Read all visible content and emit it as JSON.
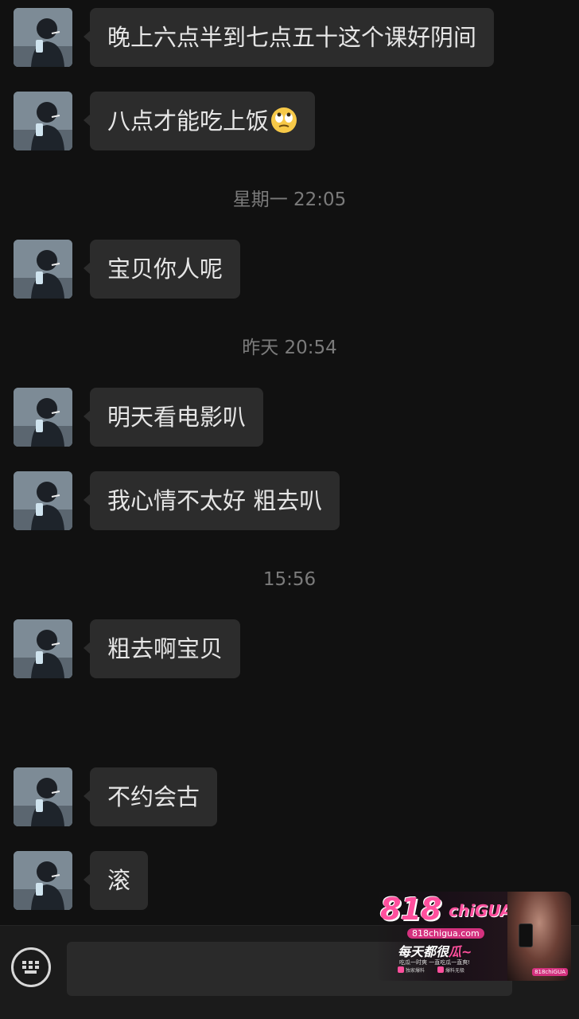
{
  "messages": [
    {
      "text": "晚上六点半到七点五十这个课好阴间"
    },
    {
      "text": "八点才能吃上饭",
      "emoji": "eye-roll-emoji"
    },
    {
      "text": "宝贝你人呢"
    },
    {
      "text": "明天看电影叭"
    },
    {
      "text": "我心情不太好 粗去叭"
    },
    {
      "text": "粗去啊宝贝"
    },
    {
      "text": "不约会古"
    },
    {
      "text": "滚"
    }
  ],
  "timestamps": [
    "星期一 22:05",
    "昨天 20:54",
    "15:56"
  ],
  "input_bar": {
    "placeholder": "",
    "keyboard_icon": "keyboard-icon"
  },
  "ad": {
    "logo": "818",
    "logo_sub": "chiGUA",
    "domain": "818chigua.com",
    "slogan_prefix": "每天都很",
    "slogan_highlight": "瓜~",
    "fine_print": "吃瓜一时爽 一直吃瓜一直爽!",
    "tag_left": "独家爆料",
    "tag_right": "爆料无极",
    "badge": "818chiGUA"
  },
  "colors": {
    "background": "#111111",
    "bubble": "#2c2c2c",
    "text": "#e6e6e6",
    "timestamp": "#7b7b7b",
    "ad_accent": "#ff4f9d"
  }
}
